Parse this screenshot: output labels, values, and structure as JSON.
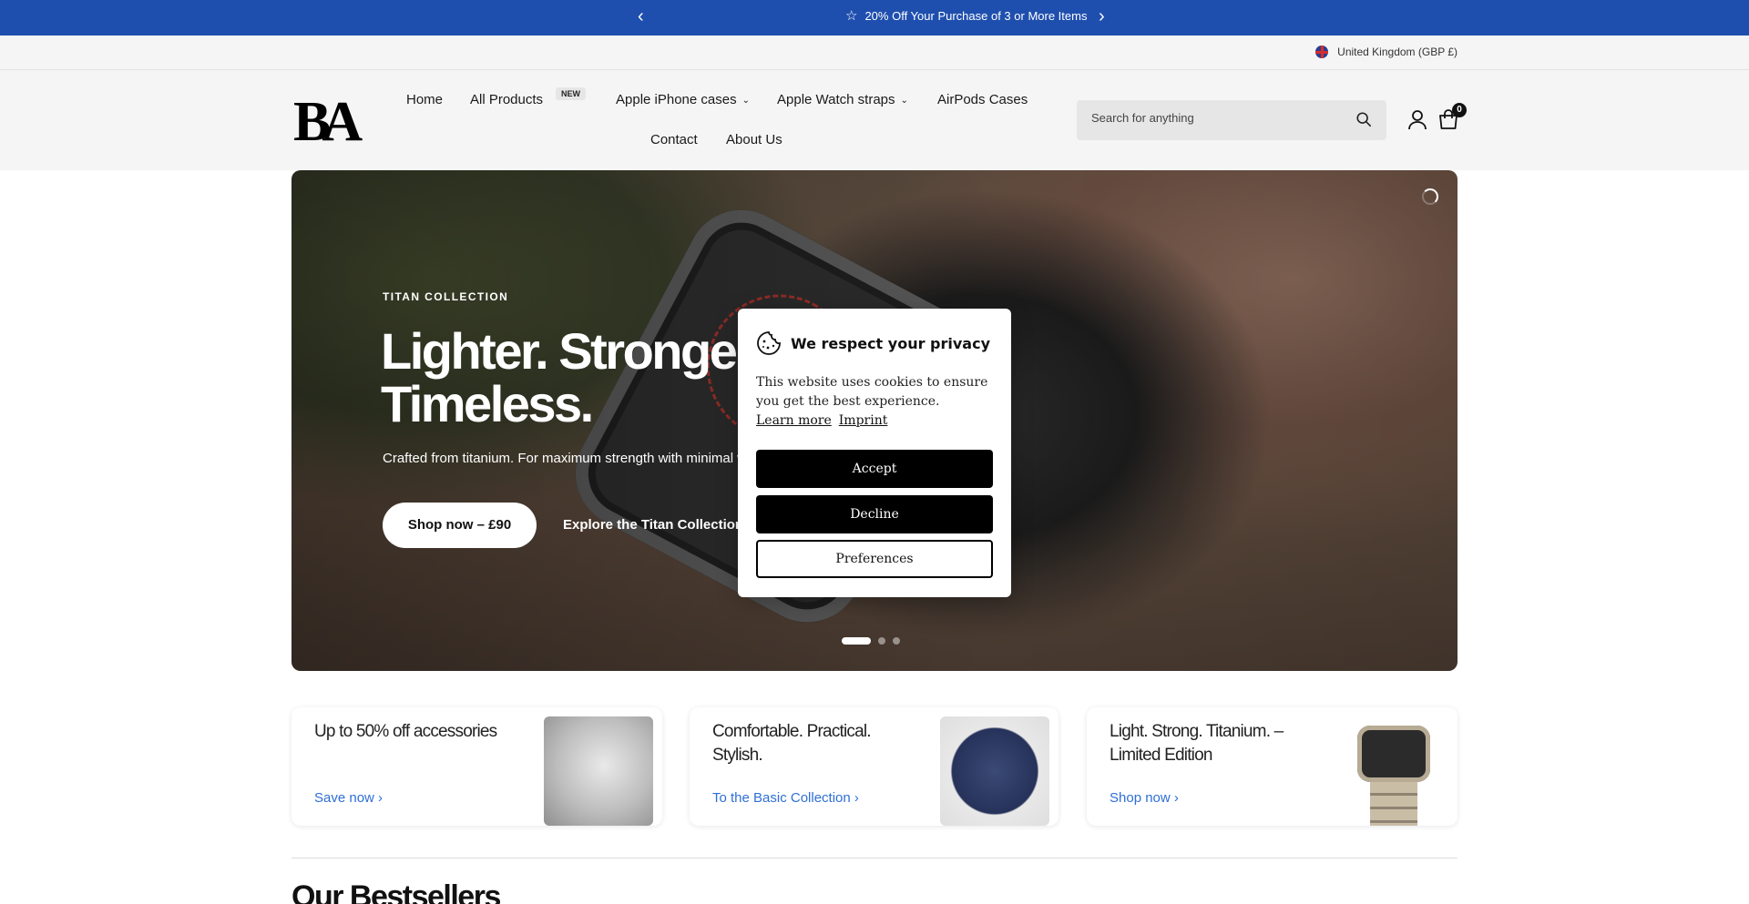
{
  "announcement": {
    "text": "20% Off Your Purchase of 3 or More Items",
    "prev_icon": "chevron-left-icon",
    "next_icon": "chevron-right-icon",
    "star_icon": "star-icon",
    "background": "#1f4fae"
  },
  "locale": {
    "label": "United Kingdom (GBP £)",
    "flag_icon": "uk-flag-icon"
  },
  "header": {
    "logo_text": "BA",
    "nav": {
      "home": "Home",
      "all_products": "All Products",
      "new_badge": "NEW",
      "iphone_cases": "Apple iPhone cases",
      "watch_straps": "Apple Watch straps",
      "airpods_cases": "AirPods Cases",
      "contact": "Contact",
      "about": "About Us"
    },
    "search_placeholder": "Search for anything",
    "cart_count": "0"
  },
  "hero": {
    "eyebrow": "TITAN COLLECTION",
    "headline": "Lighter. Stronger. Timeless.",
    "subtext": "Crafted from titanium. For maximum strength with minimal weight.",
    "primary_button": "Shop now – £90",
    "secondary_link": "Explore the Titan Collection",
    "slides_total": 3,
    "active_slide": 1
  },
  "cookie": {
    "title": "We respect your privacy",
    "body": "This website uses cookies to ensure you get the best experience.",
    "learn_more": "Learn more",
    "imprint": "Imprint",
    "accept": "Accept",
    "decline": "Decline",
    "preferences": "Preferences"
  },
  "promos": [
    {
      "title": "Up to 50% off accessories",
      "link": "Save now"
    },
    {
      "title": "Comfortable. Practical. Stylish.",
      "link": "To the Basic Collection"
    },
    {
      "title": "Light. Strong. Titanium. – Limited Edition",
      "link": "Shop now"
    }
  ],
  "colors": {
    "accent_link": "#2f6fd6"
  },
  "section": {
    "title": "Our Bestsellers"
  }
}
